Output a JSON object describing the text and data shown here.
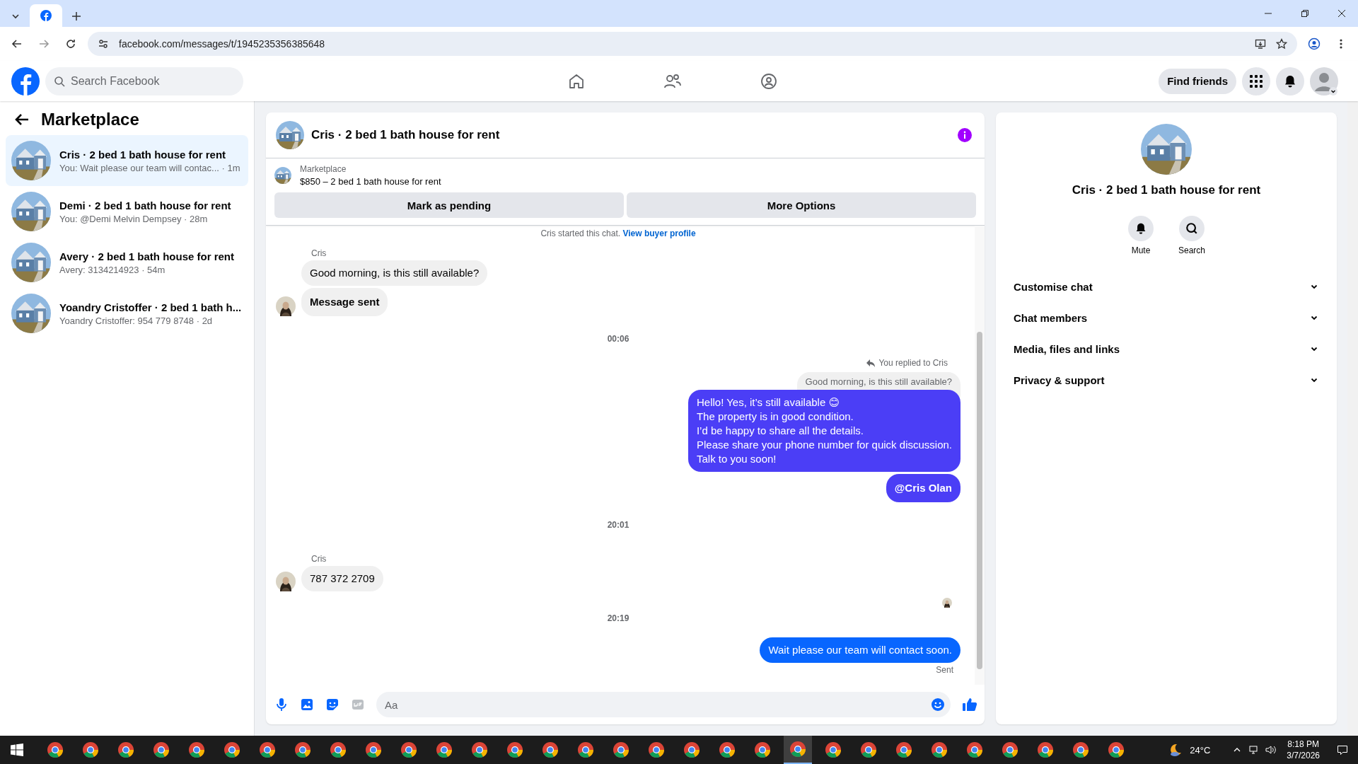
{
  "browser": {
    "url": "facebook.com/messages/t/1945235356385648"
  },
  "topbar": {
    "search_placeholder": "Search Facebook",
    "find_friends": "Find friends"
  },
  "sidebar": {
    "title": "Marketplace",
    "conversations": [
      {
        "title": "Cris · 2 bed 1 bath house for rent",
        "preview": "You: Wait please our team will contac... · 1m",
        "selected": true
      },
      {
        "title": "Demi · 2 bed 1 bath house for rent",
        "preview": "You: @Demi Melvin Dempsey · 28m",
        "selected": false
      },
      {
        "title": "Avery · 2 bed 1 bath house for rent",
        "preview": "Avery: 3134214923 · 54m",
        "selected": false
      },
      {
        "title": "Yoandry Cristoffer · 2 bed 1 bath h...",
        "preview": "Yoandry Cristoffer: 954 779 8748 · 2d",
        "selected": false
      }
    ]
  },
  "chat": {
    "title": "Cris · 2 bed 1 bath house for rent",
    "listing": {
      "source": "Marketplace",
      "summary": "$850 – 2 bed 1 bath house for rent"
    },
    "actions": [
      "Mark as pending",
      "More Options"
    ],
    "started": {
      "text": "Cris started this chat.",
      "link": "View buyer profile"
    },
    "messages": [
      {
        "kind": "sender",
        "text": "Cris"
      },
      {
        "kind": "incoming",
        "text": "Good morning, is this still available?",
        "bold": false,
        "avatar": false
      },
      {
        "kind": "incoming",
        "text": "Message sent",
        "bold": true,
        "avatar": true
      },
      {
        "kind": "timestamp",
        "text": "00:06"
      },
      {
        "kind": "reply_note",
        "text": "You replied to Cris"
      },
      {
        "kind": "quoted",
        "text": "Good morning, is this still available?"
      },
      {
        "kind": "outgoing",
        "text": "Hello! Yes, it’s still available 😊\nThe property is in good condition.\nI’d be happy to share all the details.\nPlease share your phone number for quick discussion.\nTalk to you soon!",
        "bold": false,
        "color": "#4b3ef6"
      },
      {
        "kind": "outgoing",
        "text": "@Cris Olan",
        "bold": true,
        "color": "#4b3ef6"
      },
      {
        "kind": "timestamp",
        "text": "20:01"
      },
      {
        "kind": "sender",
        "text": "Cris"
      },
      {
        "kind": "incoming",
        "text": "787 372 2709",
        "bold": false,
        "avatar": true
      },
      {
        "kind": "seen"
      },
      {
        "kind": "timestamp",
        "text": "20:19"
      },
      {
        "kind": "outgoing",
        "text": "Wait please our team will contact soon.",
        "bold": false,
        "color": "#0866ff"
      },
      {
        "kind": "status",
        "text": "Sent"
      }
    ],
    "composer": {
      "placeholder": "Aa"
    }
  },
  "details": {
    "title": "Cris · 2 bed 1 bath house for rent",
    "actions": [
      {
        "kind": "mute",
        "label": "Mute"
      },
      {
        "kind": "search",
        "label": "Search"
      }
    ],
    "sections": [
      {
        "label": "Customise chat",
        "expanded": false
      },
      {
        "label": "Chat members",
        "expanded": false
      },
      {
        "label": "Media, files and links",
        "expanded": false
      },
      {
        "label": "Privacy & support",
        "expanded": false
      }
    ]
  },
  "taskbar": {
    "apps": [
      {
        "selected": false
      },
      {
        "selected": false
      },
      {
        "selected": false
      },
      {
        "selected": false
      },
      {
        "selected": false
      },
      {
        "selected": false
      },
      {
        "selected": false
      },
      {
        "selected": false
      },
      {
        "selected": false
      },
      {
        "selected": false
      },
      {
        "selected": false
      },
      {
        "selected": false
      },
      {
        "selected": false
      },
      {
        "selected": false
      },
      {
        "selected": false
      },
      {
        "selected": false
      },
      {
        "selected": false
      },
      {
        "selected": false
      },
      {
        "selected": false
      },
      {
        "selected": false
      },
      {
        "selected": false
      },
      {
        "selected": true
      },
      {
        "selected": false
      },
      {
        "selected": false
      },
      {
        "selected": false
      },
      {
        "selected": false
      },
      {
        "selected": false
      },
      {
        "selected": false
      },
      {
        "selected": false
      },
      {
        "selected": false
      },
      {
        "selected": false
      }
    ],
    "weather": "24°C",
    "time": "8:18 PM",
    "date": "3/7/2026"
  }
}
